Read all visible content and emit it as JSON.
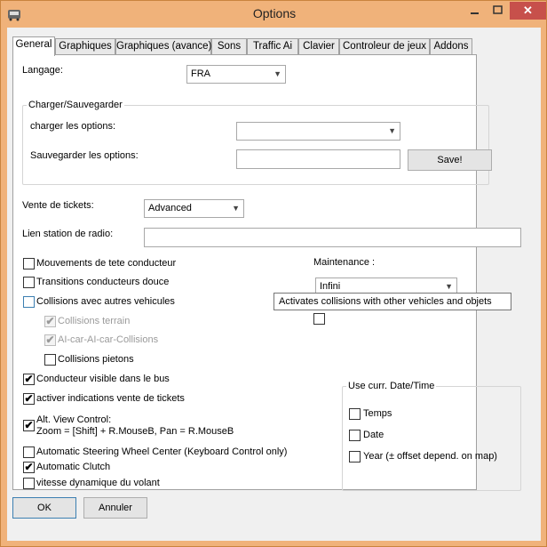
{
  "window": {
    "title": "Options",
    "close_glyph": "✕",
    "accent": "#f0b27a",
    "close_color": "#c7504b"
  },
  "tabs": [
    {
      "label": "General",
      "active": true
    },
    {
      "label": "Graphiques",
      "active": false
    },
    {
      "label": "Graphiques (avance)",
      "active": false
    },
    {
      "label": "Sons",
      "active": false
    },
    {
      "label": "Traffic Ai",
      "active": false
    },
    {
      "label": "Clavier",
      "active": false
    },
    {
      "label": "Controleur de jeux",
      "active": false
    },
    {
      "label": "Addons",
      "active": false
    }
  ],
  "general": {
    "language_label": "Langage:",
    "language_value": "FRA",
    "save_group": {
      "title": "Charger/Sauvegarder",
      "load_label": "charger les options:",
      "load_value": "",
      "save_label": "Sauvegarder les options:",
      "save_value": "",
      "save_button": "Save!"
    },
    "tickets_label": "Vente de tickets:",
    "tickets_value": "Advanced",
    "radio_label": "Lien station de radio:",
    "radio_value": "",
    "maintenance_label": "Maintenance :",
    "maintenance_value": "Infini",
    "checkboxes": [
      {
        "label": "Mouvements de tete conducteur",
        "checked": false
      },
      {
        "label": "Transitions conducteurs douce",
        "checked": false
      },
      {
        "label": "Collisions avec autres vehicules",
        "checked": false
      },
      {
        "label": "Collisions terrain",
        "checked": true,
        "disabled": true
      },
      {
        "label": "AI-car-AI-car-Collisions",
        "checked": true,
        "disabled": true
      },
      {
        "label": "Collisions pietons",
        "checked": false
      },
      {
        "label": "Conducteur visible dans le bus",
        "checked": true
      },
      {
        "label": "activer indications vente de tickets",
        "checked": true
      },
      {
        "label": "Alt. View Control:",
        "label2": "Zoom = [Shift] + R.MouseB, Pan = R.MouseB",
        "checked": true
      },
      {
        "label": "Automatic Steering Wheel Center (Keyboard Control only)",
        "checked": false
      },
      {
        "label": "Automatic Clutch",
        "checked": true
      },
      {
        "label": "vitesse dynamique du volant",
        "checked": false
      }
    ],
    "date_group": {
      "title": "Use curr. Date/Time",
      "items": [
        {
          "label": "Temps",
          "checked": false
        },
        {
          "label": "Date",
          "checked": false
        },
        {
          "label": "Year (± offset depend. on map)",
          "checked": false
        }
      ]
    },
    "tooltip": "Activates collisions with other vehicles and objets",
    "check_glyph": "✔"
  },
  "footer": {
    "ok_label": "OK",
    "cancel_label": "Annuler"
  }
}
